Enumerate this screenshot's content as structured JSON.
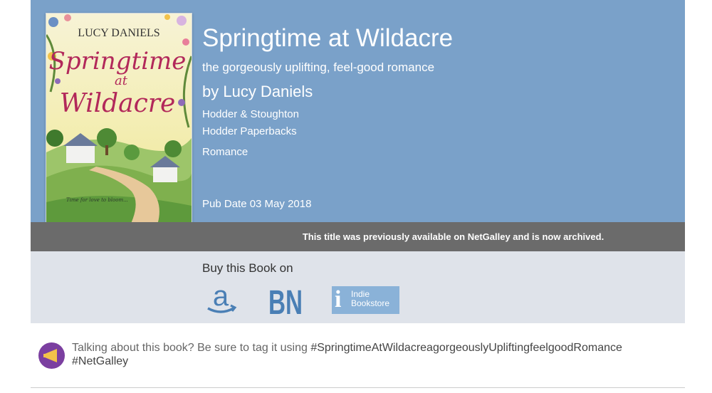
{
  "book": {
    "cover_alt": "Springtime at Wildacre cover",
    "cover_author": "LUCY DANIELS",
    "cover_title_line1": "Springtime",
    "cover_title_line2": "at",
    "cover_title_line3": "Wildacre",
    "cover_tagline": "Time for love to bloom...",
    "title": "Springtime at Wildacre",
    "subtitle": "the gorgeously uplifting, feel-good romance",
    "author": "by Lucy Daniels",
    "publisher": "Hodder & Stoughton",
    "imprint": "Hodder Paperbacks",
    "category": "Romance",
    "pub_date": "Pub Date 03 May 2018"
  },
  "archive_notice": "This title was previously available on NetGalley and is now archived.",
  "buy": {
    "label": "Buy this Book on",
    "stores": [
      "amazon",
      "BN",
      "Indie Bookstore"
    ],
    "indie_line1": "Indie",
    "indie_line2": "Bookstore",
    "bn_label": "BN"
  },
  "tagging": {
    "icon": "megaphone-icon",
    "prompt": "Talking about this book? Be sure to tag it using ",
    "hashtag_book": "#SpringtimeAtWildacreagorgeouslyUpliftingfeelgoodRomance",
    "hashtag_site": "#NetGalley"
  },
  "colors": {
    "panel_blue": "#7aa1c9",
    "archive_gray": "#6b6b6b",
    "buy_bg": "#dfe3ea",
    "store_blue": "#4a7fb5",
    "tag_purple": "#7b3fa0"
  }
}
